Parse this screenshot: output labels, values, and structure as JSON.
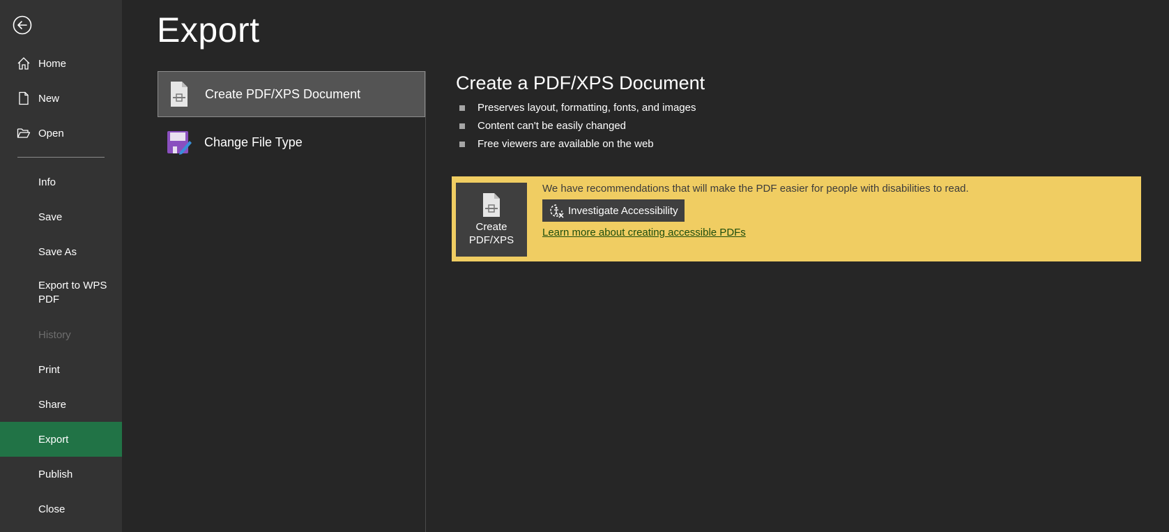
{
  "sidebar": {
    "back_icon": "back-arrow-circle-icon",
    "items": [
      {
        "label": "Home",
        "icon": "home-icon"
      },
      {
        "label": "New",
        "icon": "new-document-icon"
      },
      {
        "label": "Open",
        "icon": "open-folder-icon"
      },
      {
        "label": "Info"
      },
      {
        "label": "Save"
      },
      {
        "label": "Save As"
      },
      {
        "label": "Export to WPS PDF"
      },
      {
        "label": "History",
        "state": "disabled"
      },
      {
        "label": "Print"
      },
      {
        "label": "Share"
      },
      {
        "label": "Export",
        "state": "active"
      },
      {
        "label": "Publish"
      },
      {
        "label": "Close"
      }
    ],
    "active_color": "#217346"
  },
  "page": {
    "title": "Export"
  },
  "options": [
    {
      "label": "Create PDF/XPS Document",
      "icon": "pdf-document-icon",
      "selected": true
    },
    {
      "label": "Change File Type",
      "icon": "change-file-type-icon",
      "selected": false
    }
  ],
  "detail": {
    "title": "Create a PDF/XPS Document",
    "bullets": [
      "Preserves layout, formatting, fonts, and images",
      "Content can't be easily changed",
      "Free viewers are available on the web"
    ]
  },
  "banner": {
    "background": "#f0cd62",
    "create_button_label": "Create\nPDF/XPS",
    "message": "We have recommendations that will make the PDF easier for people with disabilities to read.",
    "investigate_label": "Investigate Accessibility",
    "investigate_icon": "accessibility-checker-icon",
    "learn_more_label": "Learn more about creating accessible PDFs"
  }
}
